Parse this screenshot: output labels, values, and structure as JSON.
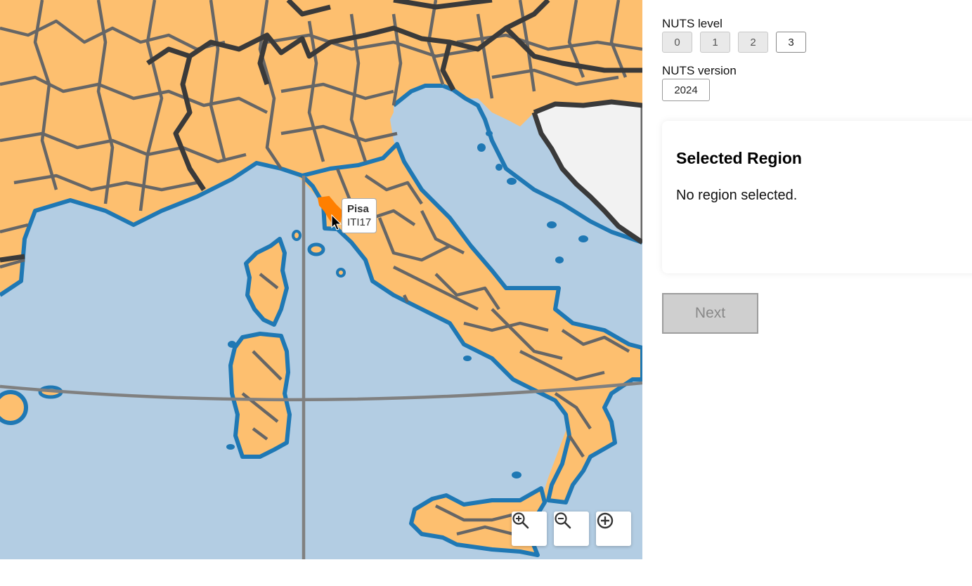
{
  "map": {
    "tooltip": {
      "name": "Pisa",
      "code": "ITI17"
    },
    "colors": {
      "sea": "#b3cde3",
      "region": "#fdbf6f",
      "highlight": "#ff7f00",
      "coast": "#1f78b4",
      "border": "#666666",
      "country_border": "#3a3a3a",
      "non_eu": "#f2f2f2",
      "graticule": "#808080"
    },
    "controls": {
      "zoom_in": "zoom-in-icon",
      "zoom_out": "zoom-out-icon",
      "reset": "reset-view-icon"
    }
  },
  "settings": {
    "nuts_level_label": "NUTS level",
    "nuts_levels": [
      "0",
      "1",
      "2",
      "3"
    ],
    "nuts_level_selected": "3",
    "nuts_version_label": "NUTS version",
    "nuts_version": "2024"
  },
  "selected_region": {
    "title": "Selected Region",
    "message": "No region selected."
  },
  "next_button": {
    "label": "Next",
    "disabled": true
  }
}
